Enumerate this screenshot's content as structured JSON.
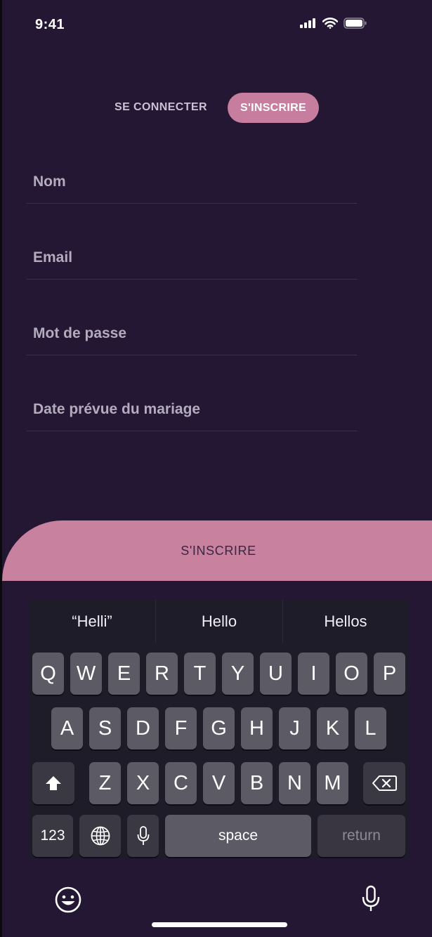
{
  "status_bar": {
    "time": "9:41",
    "icons": [
      "signal-icon",
      "wifi-icon",
      "battery-icon"
    ]
  },
  "tabs": {
    "login": "SE CONNECTER",
    "signup": "S'INSCRIRE"
  },
  "form": {
    "fields": [
      {
        "placeholder": "Nom",
        "value": ""
      },
      {
        "placeholder": "Email",
        "value": ""
      },
      {
        "placeholder": "Mot de passe",
        "value": ""
      },
      {
        "placeholder": "Date prévue du mariage",
        "value": ""
      }
    ],
    "submit_label": "S'INSCRIRE"
  },
  "keyboard": {
    "suggestions": [
      "“Helli”",
      "Hello",
      "Hellos"
    ],
    "row1": [
      "Q",
      "W",
      "E",
      "R",
      "T",
      "Y",
      "U",
      "I",
      "O",
      "P"
    ],
    "row2": [
      "A",
      "S",
      "D",
      "F",
      "G",
      "H",
      "J",
      "K",
      "L"
    ],
    "row3": [
      "Z",
      "X",
      "C",
      "V",
      "B",
      "N",
      "M"
    ],
    "numbers_key": "123",
    "space_key": "space",
    "return_key": "return"
  },
  "colors": {
    "background": "#231733",
    "accent": "#c77d9e",
    "submit": "#c8819f"
  }
}
